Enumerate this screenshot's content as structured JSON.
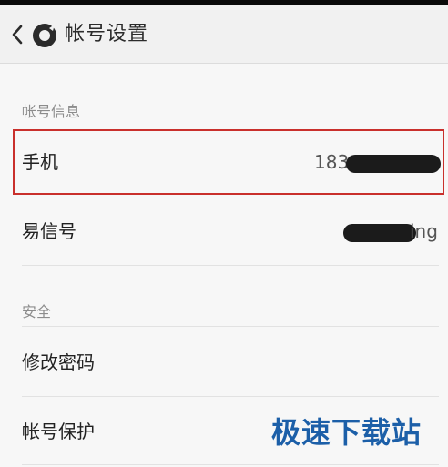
{
  "header": {
    "title": "帐号设置"
  },
  "sections": {
    "account_info": {
      "label": "帐号信息",
      "rows": [
        {
          "label": "手机",
          "value": "183"
        },
        {
          "label": "易信号",
          "value": "ing"
        }
      ]
    },
    "security": {
      "label": "安全",
      "rows": [
        {
          "label": "修改密码"
        },
        {
          "label": "帐号保护"
        }
      ]
    }
  },
  "watermark": {
    "text": "极速下载站"
  },
  "colors": {
    "highlight_border": "#c9302c",
    "watermark": "#1c5fa8",
    "header_bg": "#f1f1f1"
  }
}
